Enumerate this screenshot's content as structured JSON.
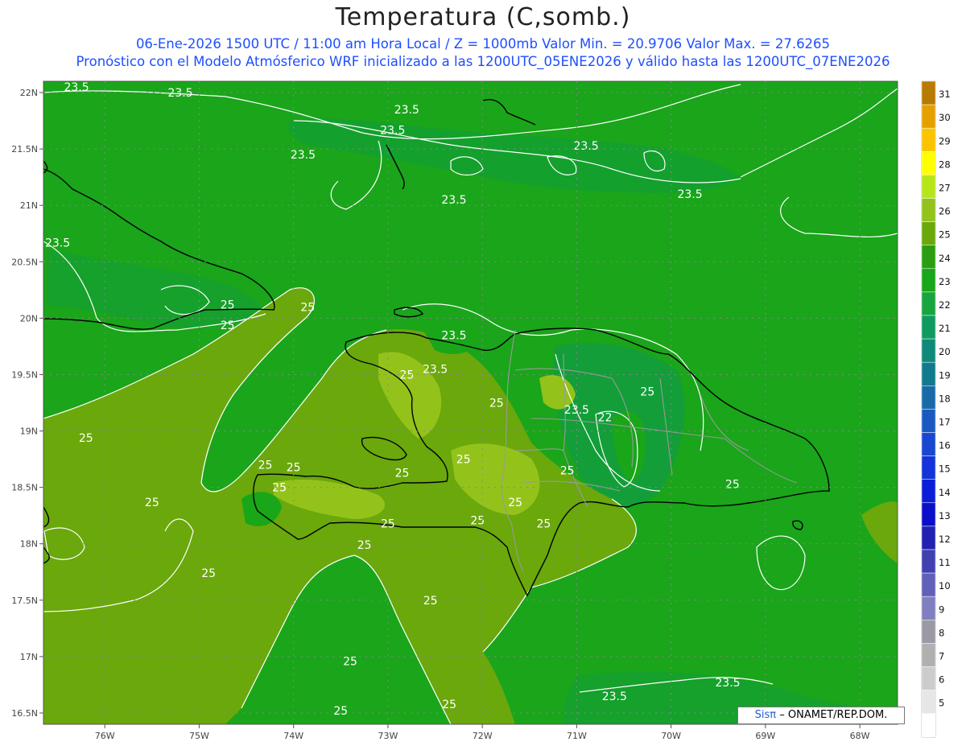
{
  "title": "Temperatura (C,somb.)",
  "subtitle_line1": "06-Ene-2026 1500 UTC / 11:00 am Hora Local / Z = 1000mb  Valor Min. = 20.9706  Valor Max. = 27.6265",
  "subtitle_line2": "Pronóstico con el Modelo Atmósferico WRF inicializado a las 1200UTC_05ENE2026 y válido hasta las  1200UTC_07ENE2026",
  "credit": {
    "logo": "Sisπ",
    "text": "– ONAMET/REP.DOM."
  },
  "colors": {
    "field_main": "#19a619",
    "field_warm": "#6aa80c",
    "field_hot": "#93c31a",
    "field_cool": "#0f9a44",
    "contour": "#ffffff",
    "coast": "#000000",
    "provinces": "#9a9a9a"
  },
  "chart_data": {
    "type": "heatmap",
    "variable": "Temperatura (C,somb.)",
    "level": "1000mb",
    "value_min": 20.9706,
    "value_max": 27.6265,
    "lon_range": [
      -76.65,
      -67.6
    ],
    "lat_range": [
      16.4,
      22.1
    ],
    "x_ticks": [
      "76W",
      "75W",
      "74W",
      "73W",
      "72W",
      "71W",
      "70W",
      "69W",
      "68W"
    ],
    "x_tick_values": [
      -76,
      -75,
      -74,
      -73,
      -72,
      -71,
      -70,
      -69,
      -68
    ],
    "y_ticks": [
      "22N",
      "21.5N",
      "21N",
      "20.5N",
      "20N",
      "19.5N",
      "19N",
      "18.5N",
      "18N",
      "17.5N",
      "17N",
      "16.5N"
    ],
    "y_tick_values": [
      22,
      21.5,
      21,
      20.5,
      20,
      19.5,
      19,
      18.5,
      18,
      17.5,
      17,
      16.5
    ],
    "colorbar": [
      {
        "value": 31,
        "color": "#b87a00"
      },
      {
        "value": 30,
        "color": "#e5a000"
      },
      {
        "value": 29,
        "color": "#fcc400"
      },
      {
        "value": 28,
        "color": "#ffff00"
      },
      {
        "value": 27,
        "color": "#b6e61a"
      },
      {
        "value": 26,
        "color": "#92c21b"
      },
      {
        "value": 25,
        "color": "#6aa80c"
      },
      {
        "value": 24,
        "color": "#2a9e10"
      },
      {
        "value": 23,
        "color": "#19a619"
      },
      {
        "value": 22,
        "color": "#17a53e"
      },
      {
        "value": 21,
        "color": "#0f9a60"
      },
      {
        "value": 20,
        "color": "#0f8a7a"
      },
      {
        "value": 19,
        "color": "#127a8f"
      },
      {
        "value": 18,
        "color": "#1a6aa8"
      },
      {
        "value": 17,
        "color": "#1a5ac0"
      },
      {
        "value": 16,
        "color": "#1a46d0"
      },
      {
        "value": 15,
        "color": "#1234d8"
      },
      {
        "value": 14,
        "color": "#0a1ed8"
      },
      {
        "value": 13,
        "color": "#0a10c8"
      },
      {
        "value": 12,
        "color": "#2222b0"
      },
      {
        "value": 11,
        "color": "#4040b0"
      },
      {
        "value": 10,
        "color": "#6060b8"
      },
      {
        "value": 9,
        "color": "#8080c0"
      },
      {
        "value": 8,
        "color": "#9a9aa6"
      },
      {
        "value": 7,
        "color": "#b0b0b0"
      },
      {
        "value": 6,
        "color": "#cccccc"
      },
      {
        "value": 5,
        "color": "#e6e6e6"
      },
      {
        "value": null,
        "color": "#ffffff"
      }
    ],
    "contour_labels": [
      {
        "text": "23.5",
        "lon": -76.3,
        "lat": 22.05
      },
      {
        "text": "23.5",
        "lon": -75.2,
        "lat": 22.0
      },
      {
        "text": "23.5",
        "lon": -72.8,
        "lat": 21.85
      },
      {
        "text": "23.5",
        "lon": -72.95,
        "lat": 21.67
      },
      {
        "text": "23.5",
        "lon": -73.9,
        "lat": 21.45
      },
      {
        "text": "23.5",
        "lon": -70.9,
        "lat": 21.53
      },
      {
        "text": "23.5",
        "lon": -69.8,
        "lat": 21.1
      },
      {
        "text": "23.5",
        "lon": -72.3,
        "lat": 21.05
      },
      {
        "text": "23.5",
        "lon": -76.5,
        "lat": 20.67
      },
      {
        "text": "25",
        "lon": -74.7,
        "lat": 20.12
      },
      {
        "text": "25",
        "lon": -73.85,
        "lat": 20.1
      },
      {
        "text": "25",
        "lon": -74.7,
        "lat": 19.94
      },
      {
        "text": "23.5",
        "lon": -72.3,
        "lat": 19.85
      },
      {
        "text": "23.5",
        "lon": -72.5,
        "lat": 19.55
      },
      {
        "text": "25",
        "lon": -72.8,
        "lat": 19.5
      },
      {
        "text": "25",
        "lon": -71.85,
        "lat": 19.25
      },
      {
        "text": "23.5",
        "lon": -71.0,
        "lat": 19.19
      },
      {
        "text": "22",
        "lon": -70.7,
        "lat": 19.12
      },
      {
        "text": "25",
        "lon": -70.25,
        "lat": 19.35
      },
      {
        "text": "25",
        "lon": -76.2,
        "lat": 18.94
      },
      {
        "text": "25",
        "lon": -74.3,
        "lat": 18.7
      },
      {
        "text": "25",
        "lon": -74.0,
        "lat": 18.68
      },
      {
        "text": "25",
        "lon": -72.2,
        "lat": 18.75
      },
      {
        "text": "25",
        "lon": -72.85,
        "lat": 18.63
      },
      {
        "text": "25",
        "lon": -71.1,
        "lat": 18.65
      },
      {
        "text": "25",
        "lon": -74.15,
        "lat": 18.5
      },
      {
        "text": "25",
        "lon": -69.35,
        "lat": 18.53
      },
      {
        "text": "25",
        "lon": -75.5,
        "lat": 18.37
      },
      {
        "text": "25",
        "lon": -71.65,
        "lat": 18.37
      },
      {
        "text": "25",
        "lon": -73.0,
        "lat": 18.18
      },
      {
        "text": "25",
        "lon": -72.05,
        "lat": 18.21
      },
      {
        "text": "25",
        "lon": -71.35,
        "lat": 18.18
      },
      {
        "text": "25",
        "lon": -73.25,
        "lat": 17.99
      },
      {
        "text": "25",
        "lon": -74.9,
        "lat": 17.74
      },
      {
        "text": "25",
        "lon": -72.55,
        "lat": 17.5
      },
      {
        "text": "25",
        "lon": -73.4,
        "lat": 16.96
      },
      {
        "text": "23.5",
        "lon": -70.6,
        "lat": 16.65
      },
      {
        "text": "23.5",
        "lon": -69.4,
        "lat": 16.77
      },
      {
        "text": "25",
        "lon": -72.35,
        "lat": 16.58
      },
      {
        "text": "25",
        "lon": -73.5,
        "lat": 16.52
      }
    ]
  }
}
